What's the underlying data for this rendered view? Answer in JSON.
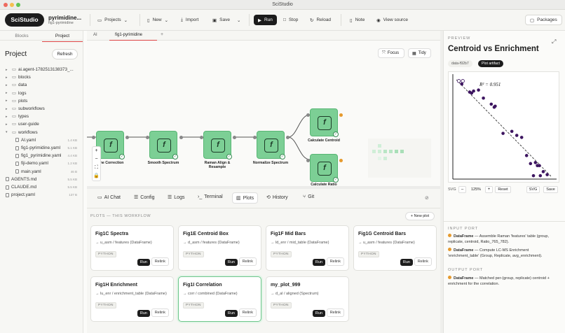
{
  "window": {
    "title": "SciStudio"
  },
  "toolbar": {
    "logo": "SciStudio",
    "project_name": "pyrimidine...",
    "project_sub": "fig1-pyrimidine",
    "projects": "Projects",
    "new": "New",
    "import": "Import",
    "save": "Save",
    "run": "Run",
    "stop": "Stop",
    "reload": "Reload",
    "note": "Note",
    "view_source": "View source",
    "packages": "Packages"
  },
  "sidebar": {
    "tabs": [
      "Blocks",
      "Project"
    ],
    "title": "Project",
    "refresh": "Refresh",
    "items": [
      {
        "label": "ai.agent-1782513138373_...",
        "type": "folder",
        "size": ""
      },
      {
        "label": "blocks",
        "type": "folder",
        "size": ""
      },
      {
        "label": "data",
        "type": "folder",
        "size": ""
      },
      {
        "label": "logs",
        "type": "folder",
        "size": ""
      },
      {
        "label": "plots",
        "type": "folder",
        "size": ""
      },
      {
        "label": "subworkflows",
        "type": "folder",
        "size": ""
      },
      {
        "label": "types",
        "type": "folder",
        "size": ""
      },
      {
        "label": "user-guide",
        "type": "folder",
        "size": ""
      },
      {
        "label": "workflows",
        "type": "folder-open",
        "size": ""
      },
      {
        "label": "AI.yaml",
        "type": "file",
        "size": "1.4 KB"
      },
      {
        "label": "fig1-pyrimidine.yaml",
        "type": "file",
        "size": "5.1 KB"
      },
      {
        "label": "fig1_pyrimidine.yaml",
        "type": "file",
        "size": "4.4 KB"
      },
      {
        "label": "fiji-demo.yaml",
        "type": "file",
        "size": "1.2 KB"
      },
      {
        "label": "main.yaml",
        "type": "file",
        "size": "46 B"
      },
      {
        "label": "AGENTS.md",
        "type": "file",
        "size": "5.5 KB"
      },
      {
        "label": "CLAUDE.md",
        "type": "file",
        "size": "5.5 KB"
      },
      {
        "label": "project.yaml",
        "type": "file",
        "size": "137 B"
      }
    ]
  },
  "editor_tabs": [
    "AI",
    "fig1-pyrimidine",
    "+"
  ],
  "canvas": {
    "focus": "Focus",
    "tidy": "Tidy",
    "nodes": [
      {
        "label": "...line Correction"
      },
      {
        "label": "Smooth Spectrum"
      },
      {
        "label": "Raman Align & Resample"
      },
      {
        "label": "Normalize Spectrum"
      },
      {
        "label": "Calculate Centroid"
      },
      {
        "label": "Calculate Ratio"
      }
    ]
  },
  "bottom_tabs": [
    "AI Chat",
    "Config",
    "Logs",
    "Terminal",
    "Plots",
    "History",
    "Git"
  ],
  "plots": {
    "section_title": "PLOTS — THIS WORKFLOW",
    "new_plot": "+ New plot",
    "cards": [
      {
        "title": "Fig1C Spectra",
        "sub": "→ u_asm / features (DataFrame)",
        "badge": "PYTHON"
      },
      {
        "title": "Fig1E Centroid Box",
        "sub": "→ d_asm / features (DataFrame)",
        "badge": "PYTHON"
      },
      {
        "title": "Fig1F Mid Bars",
        "sub": "→ ld_enr / mid_table (DataFrame)",
        "badge": "PYTHON"
      },
      {
        "title": "Fig1G Centroid Bars",
        "sub": "→ u_asm / features (DataFrame)",
        "badge": "PYTHON"
      },
      {
        "title": "Fig1H Enrichment",
        "sub": "→ lu_enr / enrichment_table (DataFrame)",
        "badge": "PYTHON"
      },
      {
        "title": "Fig1I Correlation",
        "sub": "→ corr / combined (DataFrame)",
        "badge": "PYTHON"
      },
      {
        "title": "my_plot_999",
        "sub": "→ d_al / aligned (Spectrum)",
        "badge": "PYTHON"
      }
    ],
    "run_label": "Run",
    "relink_label": "Relink"
  },
  "preview": {
    "label": "PREVIEW",
    "title": "Centroid vs Enrichment",
    "chip_id": "data-f92b7",
    "chip_artifact": "Plot artifact",
    "svg_label": "SVG",
    "zoom_minus": "–",
    "zoom": "125%",
    "zoom_plus": "+",
    "reset": "Reset",
    "svg_btn": "SVG",
    "save_btn": "Save",
    "input_port_title": "INPUT PORT",
    "input_ports": [
      {
        "name": "DataFrame",
        "desc": "— Assemble Raman 'features' table (group, replicate, centroid, Ratio_765_782)."
      },
      {
        "name": "DataFrame",
        "desc": "— Compute LC-MS Enrichment 'enrichment_table' (Group, Replicate, avg_enrichment)."
      }
    ],
    "output_port_title": "OUTPUT PORT",
    "output_ports": [
      {
        "name": "DataFrame",
        "desc": "— Matched per-(group, replicate) centroid + enrichment for the correlation."
      }
    ]
  },
  "chart_data": {
    "type": "scatter",
    "annotation": "R² = 0.951",
    "points": [
      {
        "x": 0.04,
        "y": 0.96,
        "hollow": true
      },
      {
        "x": 0.08,
        "y": 0.96,
        "hollow": true
      },
      {
        "x": 0.07,
        "y": 0.93
      },
      {
        "x": 0.15,
        "y": 0.85
      },
      {
        "x": 0.17,
        "y": 0.84
      },
      {
        "x": 0.19,
        "y": 0.86
      },
      {
        "x": 0.24,
        "y": 0.87
      },
      {
        "x": 0.29,
        "y": 0.79
      },
      {
        "x": 0.37,
        "y": 0.73
      },
      {
        "x": 0.4,
        "y": 0.7
      },
      {
        "x": 0.41,
        "y": 0.71
      },
      {
        "x": 0.49,
        "y": 0.44
      },
      {
        "x": 0.58,
        "y": 0.46
      },
      {
        "x": 0.63,
        "y": 0.42
      },
      {
        "x": 0.68,
        "y": 0.4
      },
      {
        "x": 0.73,
        "y": 0.22
      },
      {
        "x": 0.77,
        "y": 0.14
      },
      {
        "x": 0.82,
        "y": 0.15
      },
      {
        "x": 0.84,
        "y": 0.12
      },
      {
        "x": 0.86,
        "y": 0.12
      },
      {
        "x": 0.87,
        "y": 0.02
      },
      {
        "x": 0.8,
        "y": 0.02
      },
      {
        "x": 0.9,
        "y": 0.06
      },
      {
        "x": 0.94,
        "y": 0.03
      }
    ],
    "colors": {
      "point": "#3d1560",
      "line": "#222222"
    }
  }
}
